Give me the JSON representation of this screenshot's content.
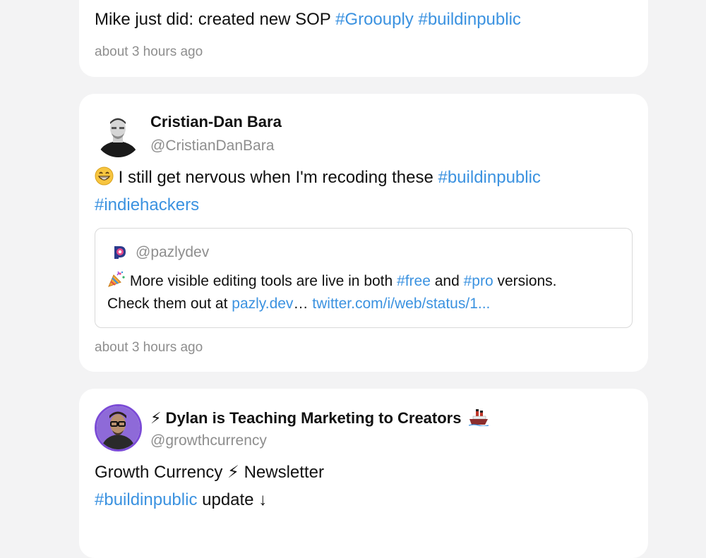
{
  "post1": {
    "text": "Mike just did: created new SOP ",
    "tags": [
      "#Groouply",
      "#buildinpublic"
    ],
    "time": "about 3 hours ago"
  },
  "post2": {
    "name": "Cristian-Dan Bara",
    "handle": "@CristianDanBara",
    "text": " I still get nervous when I'm recoding these ",
    "tag1": "#buildinpublic",
    "tag2": "#indiehackers",
    "quote": {
      "handle": "@pazlydev",
      "line1_a": " More visible editing tools are live in both ",
      "tag_free": "#free",
      "and": " and ",
      "tag_pro": "#pro",
      "line1_b": " versions.",
      "line2_a": "Check them out at ",
      "link1": "pazly.dev",
      "ellipsis": "… ",
      "link2": "twitter.com/i/web/status/1..."
    },
    "time": "about 3 hours ago"
  },
  "post3": {
    "name": "⚡ Dylan is Teaching Marketing to Creators",
    "name_emoji": "🚢",
    "handle": "@growthcurrency",
    "line1": "Growth Currency ⚡ Newsletter",
    "tag": "#buildinpublic",
    "line2_rest": " update ↓"
  },
  "colors": {
    "hashtag": "#3b92e0",
    "muted": "#8e8e8e",
    "background": "#f3f3f4",
    "card": "#ffffff"
  }
}
